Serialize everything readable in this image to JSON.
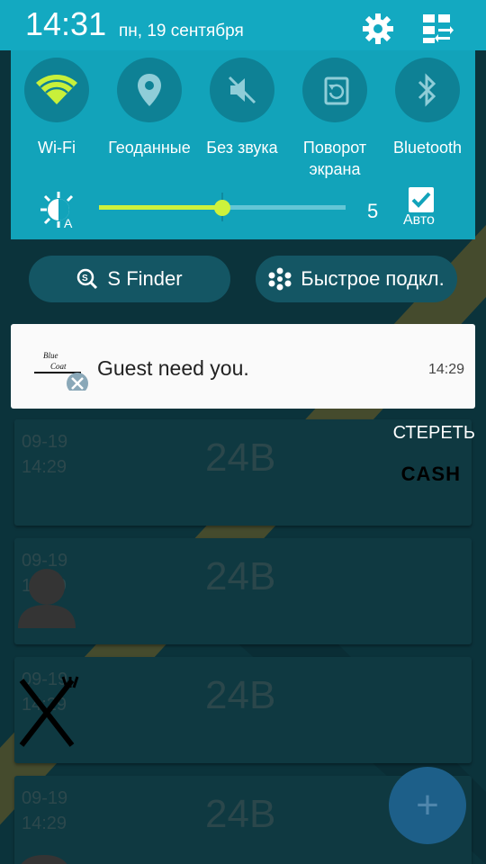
{
  "status_bar": {
    "time": "14:31",
    "date": "пн, 19 сентября"
  },
  "quick_toggles": [
    {
      "label": "Wi-Fi",
      "icon": "wifi-icon",
      "active": true
    },
    {
      "label": "Геоданные",
      "icon": "location-icon",
      "active": false
    },
    {
      "label": "Без звука",
      "icon": "mute-icon",
      "active": false
    },
    {
      "label": "Поворот\nэкрана",
      "icon": "rotate-icon",
      "active": false
    },
    {
      "label": "Bluetooth",
      "icon": "bluetooth-icon",
      "active": false
    }
  ],
  "brightness": {
    "value": "5",
    "level": 0.5,
    "auto_label": "Авто",
    "auto_checked": true
  },
  "shortcuts": {
    "s_finder": "S Finder",
    "quick_connect": "Быстрое подкл."
  },
  "notification": {
    "title": "Guest need you.",
    "time": "14:29",
    "app_icon": "blue-coat-logo-icon"
  },
  "clear_label": "СТЕРЕТЬ",
  "cash_label": "CASH",
  "orders": [
    {
      "date": "09-19",
      "time": "14:29",
      "amount": "24B"
    },
    {
      "date": "09-19",
      "time": "14:29",
      "amount": "24B"
    },
    {
      "date": "09-19",
      "time": "14:29",
      "amount": "24B"
    },
    {
      "date": "09-19",
      "time": "14:29",
      "amount": "24B"
    }
  ],
  "fab_label": "+",
  "colors": {
    "shade": "#12a3ba",
    "accent": "#cdf23c",
    "background": "#145866"
  }
}
